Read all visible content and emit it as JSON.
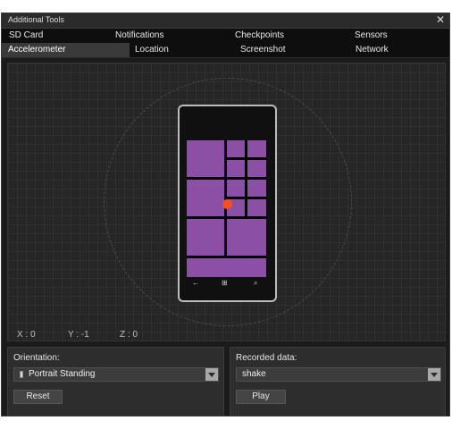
{
  "window": {
    "title": "Additional Tools",
    "close_glyph": "✕"
  },
  "tabs_row1": [
    "SD Card",
    "Notifications",
    "Checkpoints",
    "Sensors"
  ],
  "tabs_row2": [
    "Accelerometer",
    "Location",
    "Screenshot",
    "Network"
  ],
  "active_tab": "Accelerometer",
  "accelerometer": {
    "coords": {
      "x": "X : 0",
      "y": "Y : -1",
      "z": "Z : 0"
    },
    "phone_nav": {
      "back": "←",
      "windows": "⊞",
      "search": "⌕"
    },
    "tile_color": "#8c4fa6",
    "dot_color": "#f4511e"
  },
  "orientation": {
    "label": "Orientation:",
    "value": "Portrait Standing",
    "icon": "phone-portrait-icon",
    "reset_label": "Reset"
  },
  "recorded": {
    "label": "Recorded data:",
    "value": "shake",
    "play_label": "Play"
  }
}
